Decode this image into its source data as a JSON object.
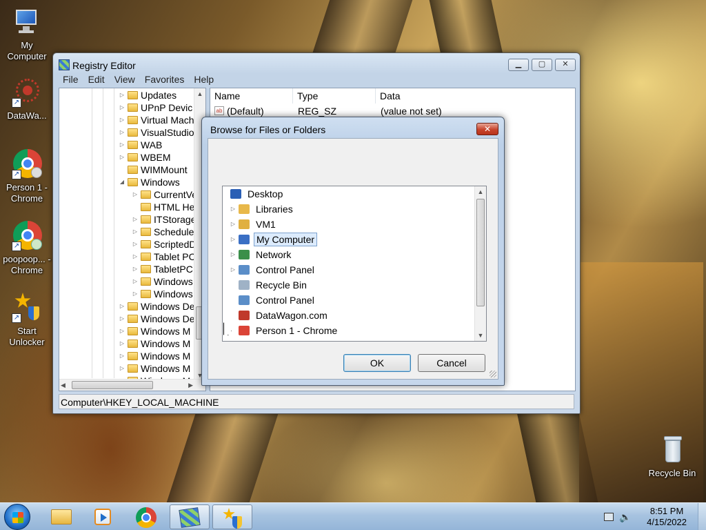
{
  "desktop": {
    "icons": [
      {
        "label": "My Computer",
        "icon": "computer-icon"
      },
      {
        "label": "DataWa...",
        "icon": "datawagon-icon"
      },
      {
        "label": "Person 1 - Chrome",
        "icon": "chrome-icon"
      },
      {
        "label": "poopoop... - Chrome",
        "icon": "chrome-icon"
      },
      {
        "label": "Start Unlocker",
        "icon": "unlocker-icon"
      },
      {
        "label": "Recycle Bin",
        "icon": "recycle-bin-icon"
      }
    ]
  },
  "regedit": {
    "title": "Registry Editor",
    "menu": [
      "File",
      "Edit",
      "View",
      "Favorites",
      "Help"
    ],
    "tree": [
      {
        "label": "Updates",
        "level": 0,
        "expander": "▷"
      },
      {
        "label": "UPnP Devic",
        "level": 0,
        "expander": "▷"
      },
      {
        "label": "Virtual Mach",
        "level": 0,
        "expander": "▷"
      },
      {
        "label": "VisualStudio",
        "level": 0,
        "expander": "▷"
      },
      {
        "label": "WAB",
        "level": 0,
        "expander": "▷"
      },
      {
        "label": "WBEM",
        "level": 0,
        "expander": "▷"
      },
      {
        "label": "WIMMount",
        "level": 0,
        "expander": ""
      },
      {
        "label": "Windows",
        "level": 0,
        "expander": "◢"
      },
      {
        "label": "CurrentVe",
        "level": 1,
        "expander": "▷"
      },
      {
        "label": "HTML He",
        "level": 1,
        "expander": ""
      },
      {
        "label": "ITStorage",
        "level": 1,
        "expander": "▷"
      },
      {
        "label": "Schedule",
        "level": 1,
        "expander": "▷"
      },
      {
        "label": "ScriptedD",
        "level": 1,
        "expander": "▷"
      },
      {
        "label": "Tablet PC",
        "level": 1,
        "expander": "▷"
      },
      {
        "label": "TabletPC",
        "level": 1,
        "expander": "▷"
      },
      {
        "label": "Windows",
        "level": 1,
        "expander": "▷"
      },
      {
        "label": "Windows",
        "level": 1,
        "expander": "▷"
      },
      {
        "label": "Windows De",
        "level": 0,
        "expander": "▷"
      },
      {
        "label": "Windows De",
        "level": 0,
        "expander": "▷"
      },
      {
        "label": "Windows M",
        "level": 0,
        "expander": "▷"
      },
      {
        "label": "Windows M",
        "level": 0,
        "expander": "▷"
      },
      {
        "label": "Windows M",
        "level": 0,
        "expander": "▷"
      },
      {
        "label": "Windows M",
        "level": 0,
        "expander": "▷"
      },
      {
        "label": "Windows M",
        "level": 0,
        "expander": "▷"
      }
    ],
    "columns": [
      "Name",
      "Type",
      "Data"
    ],
    "values": [
      {
        "name": "(Default)",
        "type": "REG_SZ",
        "data": "(value not set)"
      }
    ],
    "status": "Computer\\HKEY_LOCAL_MACHINE"
  },
  "dialog": {
    "title": "Browse for Files or Folders",
    "close_label": "✕",
    "items": [
      {
        "label": "Desktop",
        "icon": "desktop-icon",
        "color": "#2a5fb5",
        "expander": "",
        "selected": false
      },
      {
        "label": "Libraries",
        "icon": "libraries-icon",
        "color": "#e8b84a",
        "expander": "▷",
        "selected": false
      },
      {
        "label": "VM1",
        "icon": "user-folder-icon",
        "color": "#e0b040",
        "expander": "▷",
        "selected": false
      },
      {
        "label": "My Computer",
        "icon": "computer-icon",
        "color": "#3a6fc4",
        "expander": "▷",
        "selected": true
      },
      {
        "label": "Network",
        "icon": "network-icon",
        "color": "#3b8f4a",
        "expander": "▷",
        "selected": false
      },
      {
        "label": "Control Panel",
        "icon": "control-panel-icon",
        "color": "#5b8ec8",
        "expander": "▷",
        "selected": false
      },
      {
        "label": "Recycle Bin",
        "icon": "recycle-bin-icon",
        "color": "#9fb2c6",
        "expander": "",
        "selected": false
      },
      {
        "label": "Control Panel",
        "icon": "control-panel-icon",
        "color": "#5b8ec8",
        "expander": "",
        "selected": false
      },
      {
        "label": "DataWagon.com",
        "icon": "datawagon-icon",
        "color": "#c0392b",
        "expander": "",
        "selected": false
      },
      {
        "label": "Person 1 - Chrome",
        "icon": "chrome-icon",
        "color": "#db4437",
        "expander": "",
        "selected": false
      }
    ],
    "ok_label": "OK",
    "cancel_label": "Cancel"
  },
  "taskbar": {
    "items": [
      {
        "icon": "start-orb-icon"
      },
      {
        "icon": "explorer-icon"
      },
      {
        "icon": "media-player-icon"
      },
      {
        "icon": "chrome-icon"
      },
      {
        "icon": "regedit-icon"
      },
      {
        "icon": "unlocker-icon"
      }
    ],
    "time": "8:51 PM",
    "date": "4/15/2022"
  }
}
